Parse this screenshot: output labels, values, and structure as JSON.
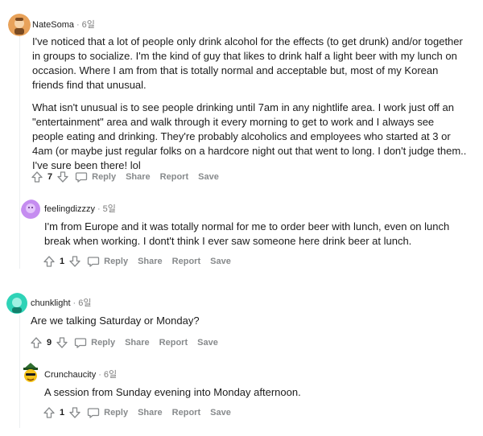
{
  "comments": [
    {
      "author": "NateSoma",
      "time": "6일",
      "paragraphs": [
        "I've noticed that a lot of people only drink alcohol for the effects (to get drunk) and/or together in groups to socialize. I'm the kind of guy that likes to drink half a light beer with my lunch on occasion. Where I am from that is totally normal and acceptable but, most of my Korean friends find that unusual.",
        "What isn't unusual is to see people drinking until 7am in any nightlife area. I work just off an \"entertainment\" area and walk through it every morning to get to work and I always see people eating and drinking. They're probably alcoholics and employees who started at 3 or 4am (or maybe just regular folks on a hardcore night out that went to long. I don't judge them.. I've sure been there! lol"
      ],
      "votes": "7",
      "avatar_color": "#e8a25a"
    },
    {
      "author": "feelingdizzzy",
      "time": "5일",
      "paragraphs": [
        "I'm from Europe and it was totally normal for me to order beer with lunch, even on lunch break when working. I dont't think I ever saw someone here drink beer at lunch."
      ],
      "votes": "1",
      "avatar_color": "#c58cf0"
    },
    {
      "author": "chunklight",
      "time": "6일",
      "paragraphs": [
        "Are we talking Saturday or Monday?"
      ],
      "votes": "9",
      "avatar_color": "#2ed3b7"
    },
    {
      "author": "Crunchaucity",
      "time": "6일",
      "paragraphs": [
        "A session from Sunday evening into Monday afternoon."
      ],
      "votes": "1",
      "avatar_color": "#3a8f3a"
    }
  ],
  "actions": {
    "reply": "Reply",
    "share": "Share",
    "report": "Report",
    "save": "Save"
  }
}
